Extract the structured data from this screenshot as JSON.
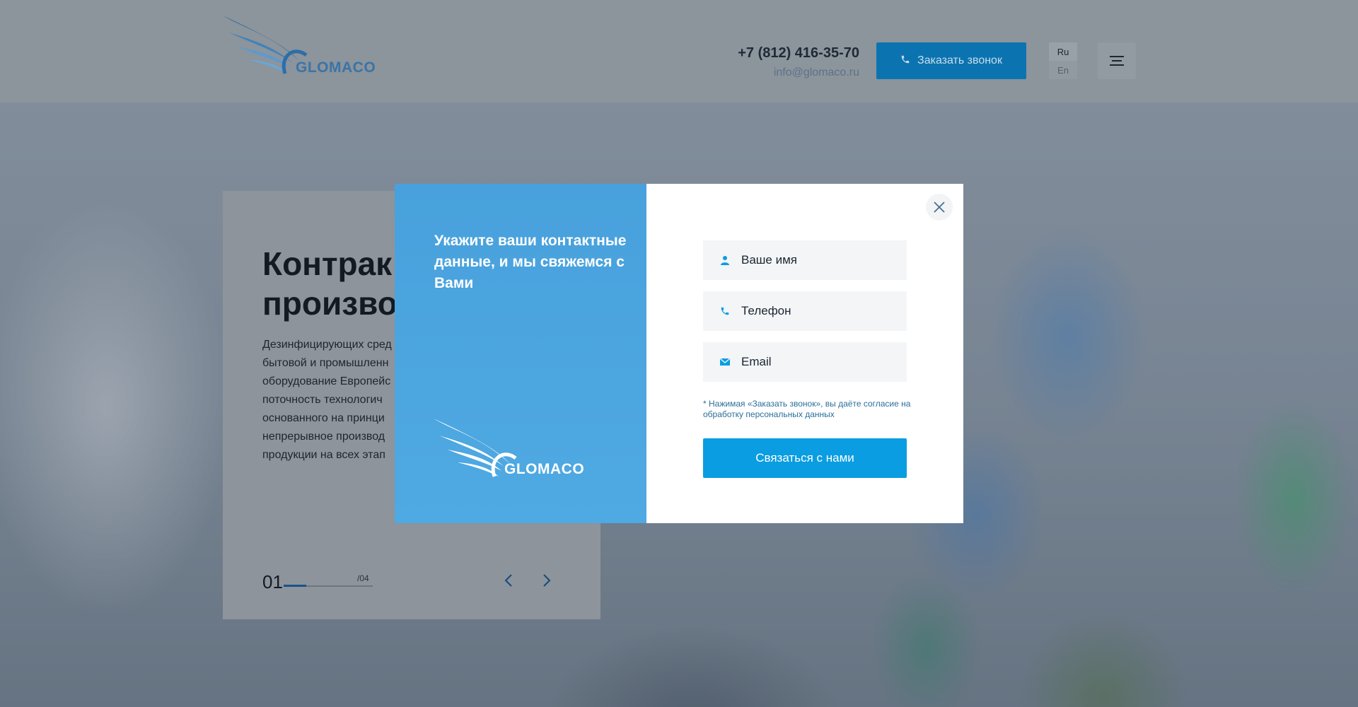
{
  "header": {
    "logo_text": "GLOMACO",
    "phone": "+7 (812) 416-35-70",
    "email": "info@glomaco.ru",
    "callback_label": "Заказать звонок",
    "lang_ru": "Ru",
    "lang_en": "En",
    "menu_icon": "hamburger-icon"
  },
  "slide": {
    "title_line1": "Контрак",
    "title_line2": "произво,",
    "text_lines": [
      "Дезинфицирующих сред",
      "бытовой и промышленн",
      "оборудование Европейс",
      "поточность технологич",
      "основанного на принци",
      "непрерывное производ",
      "продукции на всех этап"
    ],
    "current": "01",
    "total": "/04",
    "progress": 0.25
  },
  "modal": {
    "title": "Укажите ваши контактные данные, и мы свяжемся с Вами",
    "logo_text": "GLOMACO",
    "fields": {
      "name_placeholder": "Ваше имя",
      "phone_placeholder": "Телефон",
      "email_placeholder": "Email"
    },
    "consent": "* Нажимая «Заказать звонок», вы даёте согласие на обработку персональных данных",
    "submit_label": "Связаться с нами"
  },
  "colors": {
    "accent": "#0a9de1",
    "modal_left": "#4fa9e2",
    "brand": "#3a74a6"
  }
}
